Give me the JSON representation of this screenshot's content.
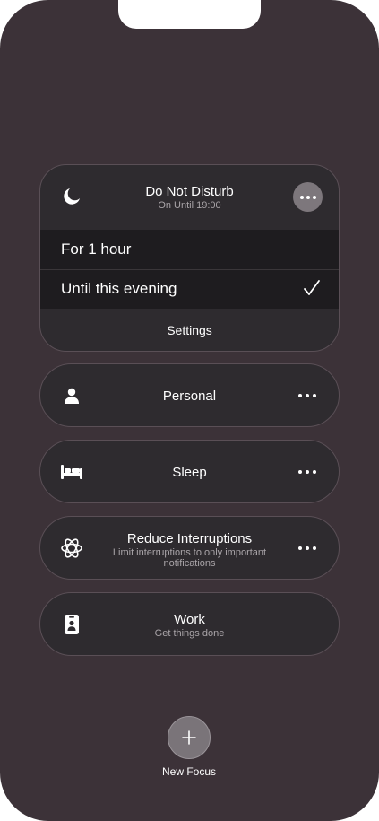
{
  "dnd": {
    "title": "Do Not Disturb",
    "subtitle": "On Until 19:00",
    "icon": "moon-icon",
    "more_icon": "ellipsis-icon",
    "options": [
      {
        "label": "For 1 hour",
        "selected": false
      },
      {
        "label": "Until this evening",
        "selected": true
      }
    ],
    "settings_label": "Settings"
  },
  "focus_modes": [
    {
      "title": "Personal",
      "subtitle": "",
      "icon": "person-icon",
      "has_more": true
    },
    {
      "title": "Sleep",
      "subtitle": "",
      "icon": "bed-icon",
      "has_more": true
    },
    {
      "title": "Reduce Interruptions",
      "subtitle": "Limit interruptions to only important notifications",
      "icon": "atom-icon",
      "has_more": true
    },
    {
      "title": "Work",
      "subtitle": "Get things done",
      "icon": "id-badge-icon",
      "has_more": false
    }
  ],
  "new_focus": {
    "label": "New Focus",
    "icon": "plus-icon"
  },
  "colors": {
    "background": "#3c3238",
    "card": "#2e2b2f",
    "option_row": "#1e1c1f",
    "more_circle": "#7d777c"
  }
}
